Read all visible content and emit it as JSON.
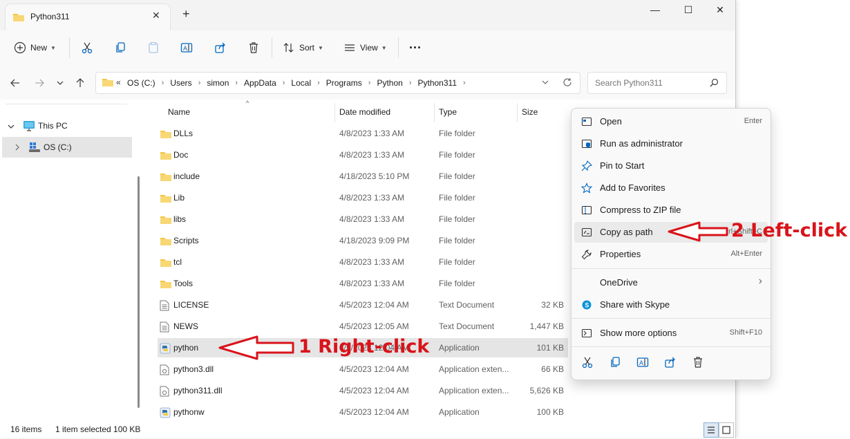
{
  "window": {
    "tab_title": "Python311",
    "new_tab": "+",
    "controls": {
      "minimize": "—",
      "maximize": "☐",
      "close": "✕"
    }
  },
  "toolbar": {
    "new_label": "New",
    "sort_label": "Sort",
    "view_label": "View",
    "more_label": "···"
  },
  "address": {
    "overflow": "«",
    "crumbs": [
      "OS (C:)",
      "Users",
      "simon",
      "AppData",
      "Local",
      "Programs",
      "Python",
      "Python311"
    ]
  },
  "search": {
    "placeholder": "Search Python311"
  },
  "navpane": {
    "this_pc": "This PC",
    "drive": "OS (C:)"
  },
  "columns": {
    "name": "Name",
    "date": "Date modified",
    "type": "Type",
    "size": "Size"
  },
  "files": [
    {
      "name": "DLLs",
      "date": "4/8/2023 1:33 AM",
      "type": "File folder",
      "size": "",
      "icon": "folder"
    },
    {
      "name": "Doc",
      "date": "4/8/2023 1:33 AM",
      "type": "File folder",
      "size": "",
      "icon": "folder"
    },
    {
      "name": "include",
      "date": "4/18/2023 5:10 PM",
      "type": "File folder",
      "size": "",
      "icon": "folder"
    },
    {
      "name": "Lib",
      "date": "4/8/2023 1:33 AM",
      "type": "File folder",
      "size": "",
      "icon": "folder"
    },
    {
      "name": "libs",
      "date": "4/8/2023 1:33 AM",
      "type": "File folder",
      "size": "",
      "icon": "folder"
    },
    {
      "name": "Scripts",
      "date": "4/18/2023 9:09 PM",
      "type": "File folder",
      "size": "",
      "icon": "folder"
    },
    {
      "name": "tcl",
      "date": "4/8/2023 1:33 AM",
      "type": "File folder",
      "size": "",
      "icon": "folder"
    },
    {
      "name": "Tools",
      "date": "4/8/2023 1:33 AM",
      "type": "File folder",
      "size": "",
      "icon": "folder"
    },
    {
      "name": "LICENSE",
      "date": "4/5/2023 12:04 AM",
      "type": "Text Document",
      "size": "32 KB",
      "icon": "text"
    },
    {
      "name": "NEWS",
      "date": "4/5/2023 12:05 AM",
      "type": "Text Document",
      "size": "1,447 KB",
      "icon": "text"
    },
    {
      "name": "python",
      "date": "4/5/2023 12:04 AM",
      "type": "Application",
      "size": "101 KB",
      "icon": "python",
      "selected": true
    },
    {
      "name": "python3.dll",
      "date": "4/5/2023 12:04 AM",
      "type": "Application exten...",
      "size": "66 KB",
      "icon": "dll"
    },
    {
      "name": "python311.dll",
      "date": "4/5/2023 12:04 AM",
      "type": "Application exten...",
      "size": "5,626 KB",
      "icon": "dll"
    },
    {
      "name": "pythonw",
      "date": "4/5/2023 12:04 AM",
      "type": "Application",
      "size": "100 KB",
      "icon": "python"
    }
  ],
  "status": {
    "count": "16 items",
    "selection": "1 item selected  100 KB"
  },
  "context_menu": {
    "items": [
      {
        "label": "Open",
        "shortcut": "Enter",
        "icon": "open-icon"
      },
      {
        "label": "Run as administrator",
        "shortcut": "",
        "icon": "shield-icon"
      },
      {
        "label": "Pin to Start",
        "shortcut": "",
        "icon": "pin-icon"
      },
      {
        "label": "Add to Favorites",
        "shortcut": "",
        "icon": "star-icon"
      },
      {
        "label": "Compress to ZIP file",
        "shortcut": "",
        "icon": "zip-icon"
      },
      {
        "label": "Copy as path",
        "shortcut": "Ctrl+Shift+C",
        "icon": "copy-path-icon"
      },
      {
        "label": "Properties",
        "shortcut": "Alt+Enter",
        "icon": "wrench-icon"
      },
      {
        "label": "OneDrive",
        "shortcut": "›",
        "icon": ""
      },
      {
        "label": "Share with Skype",
        "shortcut": "",
        "icon": "skype-icon"
      },
      {
        "label": "Show more options",
        "shortcut": "Shift+F10",
        "icon": "more-options-icon"
      }
    ]
  },
  "annotations": {
    "step1": "1 Right-click",
    "step2": "2 Left-click",
    "color": "#d9131a"
  },
  "colors": {
    "folder": "#f4c542",
    "accent": "#0067c0",
    "selection": "#e5e5e5"
  }
}
